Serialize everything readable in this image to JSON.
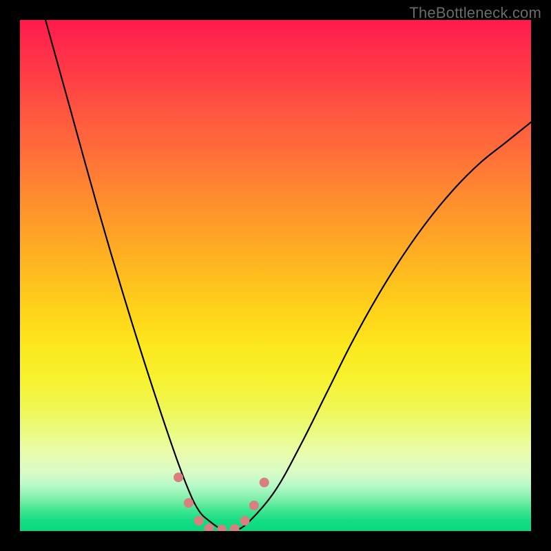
{
  "watermark": "TheBottleneck.com",
  "chart_data": {
    "type": "line",
    "title": "",
    "xlabel": "",
    "ylabel": "",
    "xlim": [
      0,
      100
    ],
    "ylim": [
      0,
      100
    ],
    "grid": false,
    "series": [
      {
        "name": "curve",
        "color": "#000000",
        "x": [
          5,
          10,
          15,
          20,
          25,
          30,
          33,
          35,
          37,
          40,
          42,
          45,
          50,
          55,
          60,
          65,
          70,
          75,
          80,
          85,
          90,
          95,
          100
        ],
        "y": [
          100,
          82,
          64,
          47,
          31,
          16,
          8,
          4,
          2,
          0,
          0,
          2,
          8,
          17,
          27,
          37,
          46,
          54,
          61,
          67,
          72,
          76,
          80
        ]
      }
    ],
    "markers": {
      "name": "highlight-points",
      "color": "#d88080",
      "radius_px": 7,
      "x": [
        31.0,
        33.0,
        35.0,
        37.0,
        39.5,
        42.0,
        44.0,
        45.8,
        47.8
      ],
      "y": [
        10.5,
        5.5,
        2.0,
        0.5,
        0.3,
        0.4,
        2.0,
        5.0,
        9.5
      ]
    },
    "background": {
      "type": "vertical-gradient",
      "stops": [
        {
          "pos": 0.0,
          "color": "#ff1a4d"
        },
        {
          "pos": 0.3,
          "color": "#ff7a34"
        },
        {
          "pos": 0.55,
          "color": "#ffce1d"
        },
        {
          "pos": 0.78,
          "color": "#f0f654"
        },
        {
          "pos": 0.9,
          "color": "#c7fac3"
        },
        {
          "pos": 1.0,
          "color": "#08d97e"
        }
      ]
    }
  }
}
